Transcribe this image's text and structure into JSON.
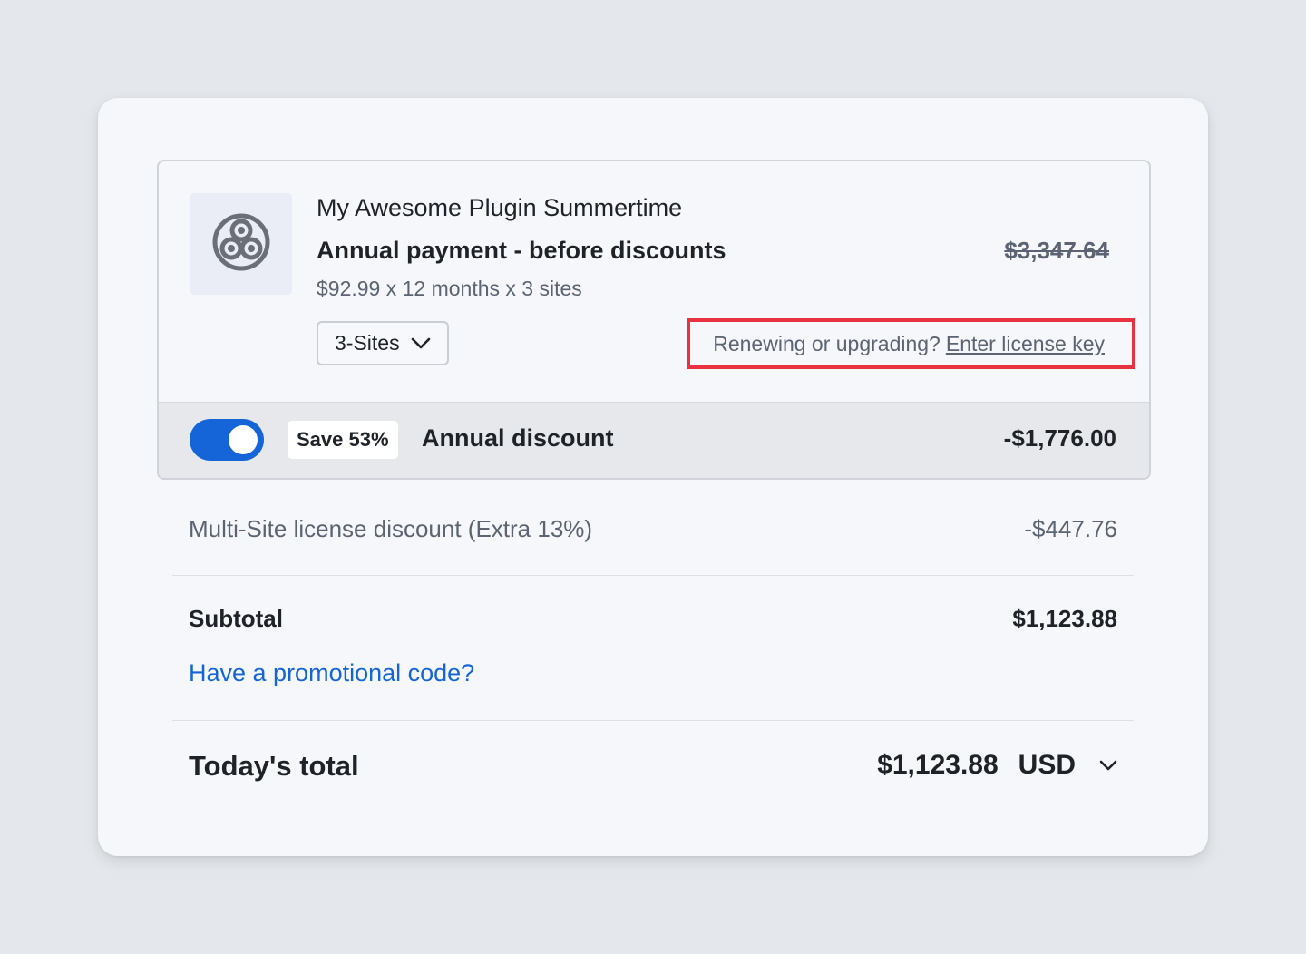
{
  "product": {
    "name": "My Awesome Plugin Summertime",
    "logo_icon": "triskelion-logo-icon",
    "plan_title": "Annual payment - before discounts",
    "plan_price_original": "$3,347.64",
    "plan_calculation": "$92.99 x 12 months x 3 sites",
    "sites_select": {
      "selected": "3-Sites",
      "icon": "chevron-down-icon"
    },
    "license": {
      "prompt": "Renewing or upgrading?",
      "link_label": "Enter license key",
      "highlight_color": "#e8323f"
    }
  },
  "annual_discount": {
    "toggle_on": true,
    "badge": "Save 53%",
    "label": "Annual discount",
    "amount": "-$1,776.00"
  },
  "multisite_discount": {
    "label": "Multi-Site license discount (Extra 13%)",
    "amount": "-$447.76"
  },
  "subtotal": {
    "label": "Subtotal",
    "amount": "$1,123.88"
  },
  "promo": {
    "link_label": "Have a promotional code?"
  },
  "total": {
    "label": "Today's total",
    "amount": "$1,123.88",
    "currency": "USD",
    "currency_icon": "chevron-down-icon"
  },
  "colors": {
    "accent": "#1565d8",
    "highlight": "#e8323f",
    "page_background": "#e4e7eb",
    "card_background": "#f5f7fb"
  }
}
